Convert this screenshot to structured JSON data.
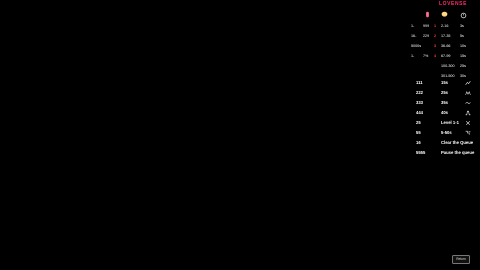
{
  "brand": "LOVENSE",
  "header_icons": [
    "toy-icon",
    "coin-icon",
    "timer-icon"
  ],
  "tip_table": [
    {
      "tokens": "1-",
      "c2": "999",
      "level": "1",
      "range": "2-16",
      "duration": "3s"
    },
    {
      "tokens": "16-",
      "c2": "229",
      "level": "2",
      "range": "17-35",
      "duration": "5s"
    },
    {
      "tokens": "5000s",
      "c2": "",
      "level": "3",
      "range": "36-66",
      "duration": "10s"
    },
    {
      "tokens": "1-",
      "c2": "7%",
      "level": "4",
      "range": "67-99",
      "duration": "15s"
    },
    {
      "tokens": "",
      "c2": "",
      "level": "",
      "range": "100-300",
      "duration": "25s"
    },
    {
      "tokens": "",
      "c2": "",
      "level": "",
      "range": "301-500",
      "duration": "30s"
    }
  ],
  "commands": [
    {
      "code": "111",
      "value": "15s",
      "icon": "wave-icon"
    },
    {
      "code": "222",
      "value": "25s",
      "icon": "zigzag-icon"
    },
    {
      "code": "333",
      "value": "35s",
      "icon": "tilde-icon"
    },
    {
      "code": "444",
      "value": "40s",
      "icon": "pulse-icon"
    },
    {
      "code": "25",
      "value": "Level 1-1",
      "icon": "cross-icon"
    },
    {
      "code": "55",
      "value": "5-50s",
      "icon": "random-icon"
    },
    {
      "code": "16",
      "value": "Clear the Queue",
      "icon": ""
    },
    {
      "code": "5555",
      "value": "Pause the queue",
      "icon": ""
    }
  ],
  "badge_label": "Return",
  "colors": {
    "background": "#000000",
    "brand": "#ff2d6f",
    "level_accent": "#ff3b3b"
  }
}
